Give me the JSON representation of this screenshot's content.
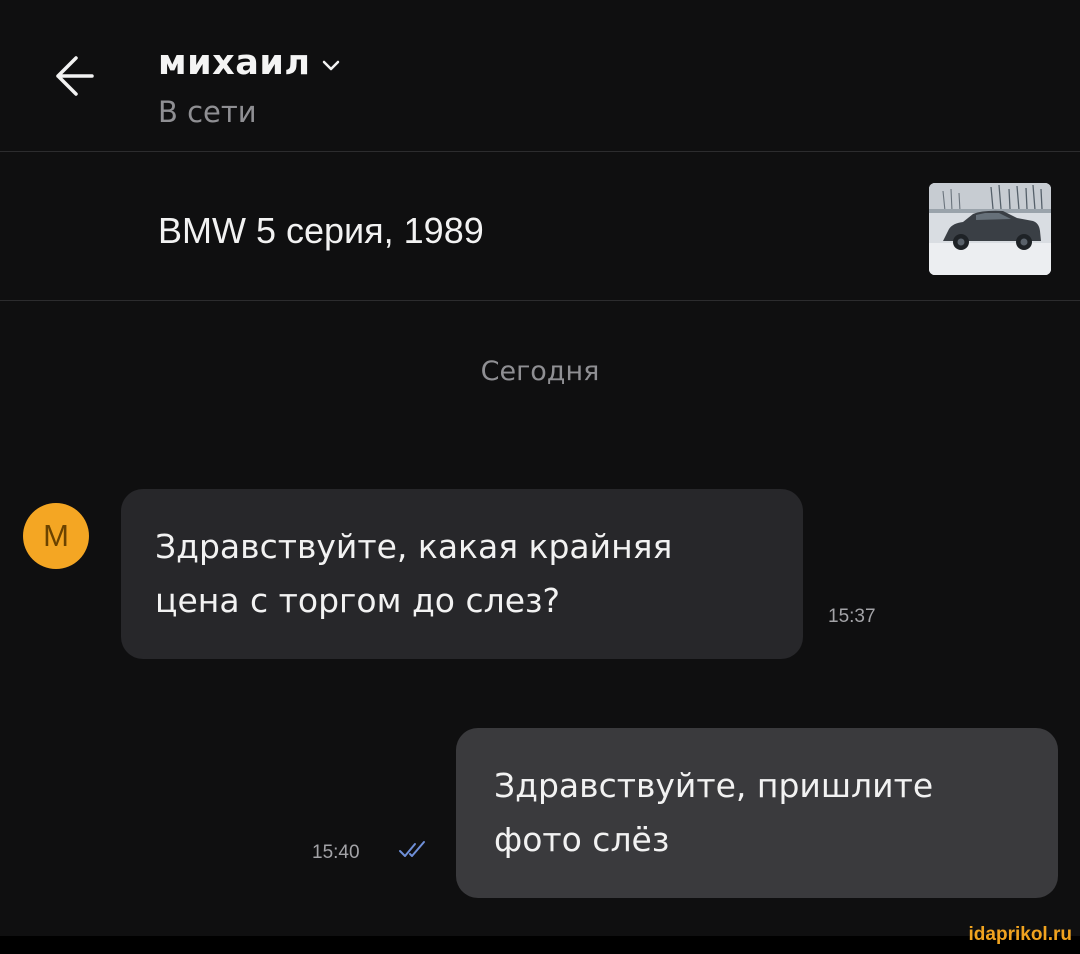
{
  "header": {
    "contact_name": "михаил",
    "status": "В сети"
  },
  "listing": {
    "title": "BMW 5 серия, 1989",
    "thumbnail": "car-photo"
  },
  "chat": {
    "date_separator": "Сегодня",
    "messages": [
      {
        "direction": "incoming",
        "avatar_letter": "М",
        "lines": [
          "Здравствуйте, какая крайняя",
          "цена с торгом до слез?"
        ],
        "time": "15:37"
      },
      {
        "direction": "outgoing",
        "lines": [
          "Здравствуйте, пришлите",
          "фото слёз"
        ],
        "time": "15:40",
        "read": true
      }
    ]
  },
  "watermark": "idaprikol.ru",
  "colors": {
    "background": "#0f0f10",
    "incoming_bubble": "#27272a",
    "outgoing_bubble": "#3a3a3d",
    "avatar": "#f4a623",
    "read_ticks": "#6f8fd8",
    "watermark": "#f0a31f"
  },
  "icons": {
    "back": "arrow-left-icon",
    "dropdown": "chevron-down-icon",
    "read_status": "double-check-icon"
  }
}
